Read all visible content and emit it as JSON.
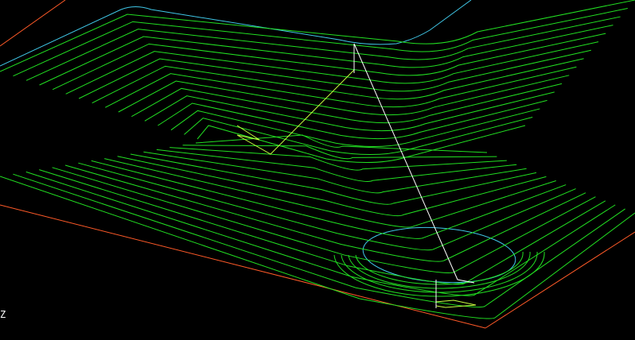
{
  "viewport": {
    "background": "#000000",
    "axis_indicator": "Z"
  },
  "colors": {
    "toolpath": "#22e022",
    "toolpath_bright": "#c8ff40",
    "boundary": "#40c8e8",
    "stock_edge": "#ff5a28",
    "rapid_move": "#ffffff"
  },
  "layers": [
    {
      "name": "stock-boundary",
      "color": "#ff5a28"
    },
    {
      "name": "part-boundary",
      "color": "#40c8e8"
    },
    {
      "name": "pocket-toolpath",
      "color": "#22e022"
    },
    {
      "name": "linking-moves",
      "color": "#c8ff40"
    },
    {
      "name": "rapid-moves",
      "color": "#ffffff"
    }
  ]
}
